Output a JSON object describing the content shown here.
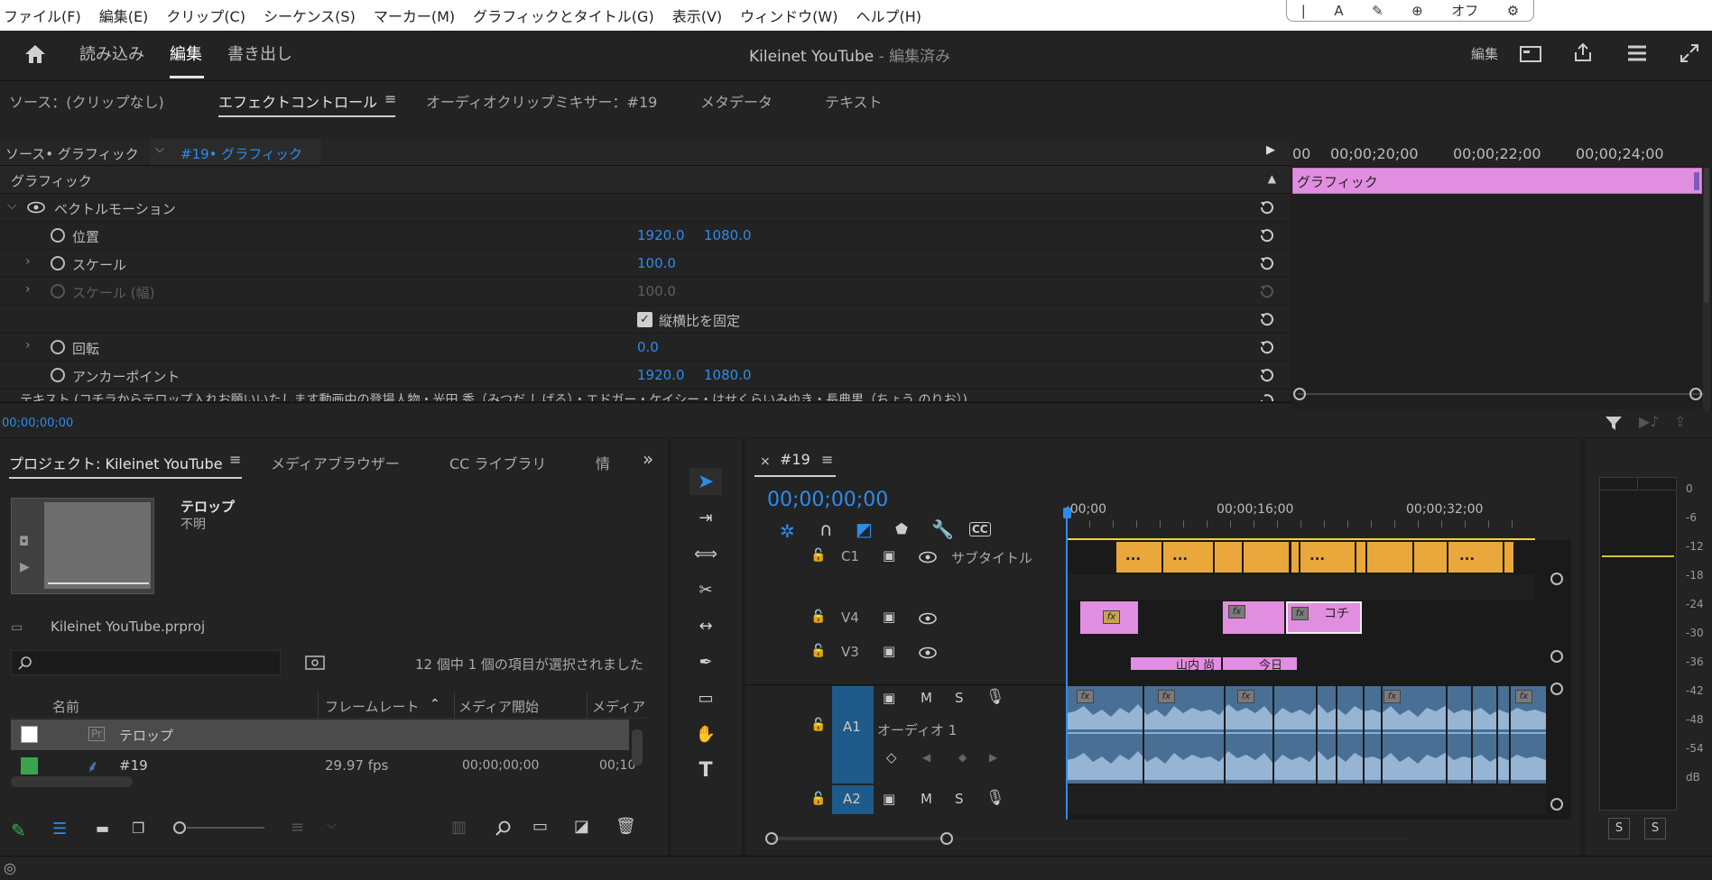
{
  "menu": {
    "items": [
      "ファイル(F)",
      "編集(E)",
      "クリップ(C)",
      "シーケンス(S)",
      "マーカー(M)",
      "グラフィックとタイトル(G)",
      "表示(V)",
      "ウィンドウ(W)",
      "ヘルプ(H)"
    ]
  },
  "floatbar": {
    "label": "オフ"
  },
  "header": {
    "tabs": [
      "読み込み",
      "編集",
      "書き出し"
    ],
    "title": "Kileinet YouTube",
    "title_suffix": " - 編集済み",
    "workspace_label": "編集"
  },
  "source_panel": {
    "tabs": [
      "ソース：(クリップなし)",
      "エフェクトコントロール",
      "オーディオクリップミキサー：#19",
      "メタデータ",
      "テキスト"
    ],
    "source_crumb": "ソース• グラフィック",
    "seq_crumb": "#19• グラフィック",
    "section": "グラフィック",
    "group": "ベクトルモーション",
    "props": {
      "position": {
        "label": "位置",
        "x": "1920.0",
        "y": "1080.0"
      },
      "scale": {
        "label": "スケール",
        "value": "100.0"
      },
      "scale_width": {
        "label": "スケール (幅)",
        "value": "100.0"
      },
      "uniform": {
        "label": "縦横比を固定"
      },
      "rotation": {
        "label": "回転",
        "value": "0.0"
      },
      "anchor": {
        "label": "アンカーポイント",
        "x": "1920.0",
        "y": "1080.0"
      }
    },
    "text_row": "テキスト (コチラからテロップ入れお願いいたします動画中の登場人物・光田 秀（みつだ しげる）・エドガー・ケイシー・はせくらいみゆき・長典男（ちょう のりお）)",
    "timecode": "00;00;00;00",
    "ruler": [
      "00",
      "00;00;20;00",
      "00;00;22;00",
      "00;00;24;00"
    ],
    "clip_label": "グラフィック"
  },
  "project_panel": {
    "tabs": [
      "プロジェクト: Kileinet YouTube",
      "メディアブラウザー",
      "CC ライブラリ",
      "情"
    ],
    "preview_name": "テロップ",
    "preview_sub": "不明",
    "project_file": "Kileinet YouTube.prproj",
    "search_placeholder": "",
    "selection_status": "12 個中 1 個の項目が選択されました",
    "columns": [
      "名前",
      "フレームレート",
      "メディア開始",
      "メディア"
    ],
    "rows": [
      {
        "name": "テロップ",
        "fps": "",
        "start": "",
        "end": ""
      },
      {
        "name": "#19",
        "fps": "29.97 fps",
        "start": "00;00;00;00",
        "end": "00;10"
      }
    ]
  },
  "timeline": {
    "seq_name": "#19",
    "timecode": "00;00;00;00",
    "ruler": [
      ";00;00",
      "00;00;16;00",
      "00;00;32;00"
    ],
    "tracks": {
      "c1": {
        "id": "C1",
        "name": "サブタイトル"
      },
      "v4": {
        "id": "V4"
      },
      "v3": {
        "id": "V3"
      },
      "a1": {
        "id": "A1",
        "name": "オーディオ 1"
      },
      "a2": {
        "id": "A2"
      }
    },
    "m": "M",
    "s": "S",
    "clip_texts": {
      "kochi": "コチ",
      "yamauchi": "山内 尚",
      "kyou": "今日"
    },
    "caption_dots": "..."
  },
  "meter": {
    "scale": [
      "0",
      "-6",
      "-12",
      "-18",
      "-24",
      "-30",
      "-36",
      "-42",
      "-48",
      "-54",
      "dB"
    ],
    "solo": "S"
  },
  "colors": {
    "accent": "#2d8ceb",
    "graphic_clip": "#e28ee0",
    "caption_clip": "#e9a73c",
    "audio_clip": "#4a6f95",
    "track_select": "#1e5a8a"
  }
}
